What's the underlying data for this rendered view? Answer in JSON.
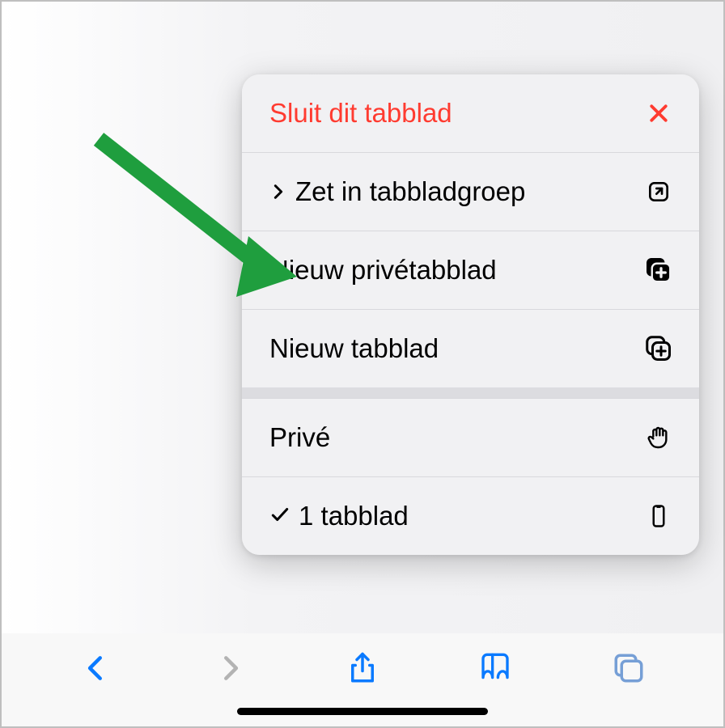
{
  "menu": {
    "close_tab": "Sluit dit tabblad",
    "move_to_group": "Zet in tabbladgroep",
    "new_private_tab": "Nieuw privétabblad",
    "new_tab": "Nieuw tabblad",
    "private": "Privé",
    "one_tab": "1 tabblad"
  },
  "colors": {
    "danger": "#ff3b30",
    "accent": "#0a7aff",
    "arrow": "#1f9e3e"
  }
}
